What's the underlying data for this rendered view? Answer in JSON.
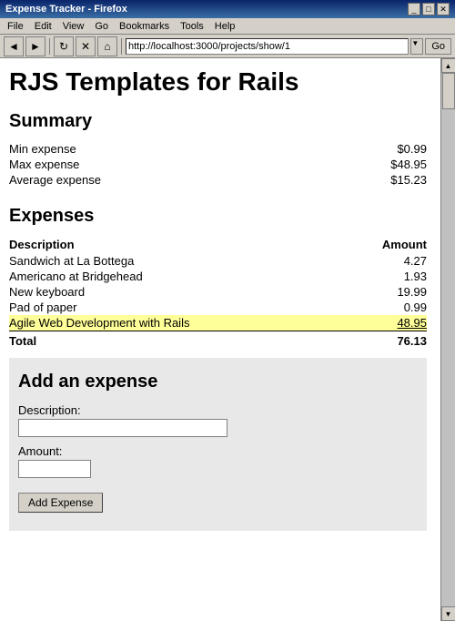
{
  "window": {
    "title": "Expense Tracker - Firefox",
    "controls": {
      "minimize": "_",
      "maximize": "□",
      "close": "✕"
    }
  },
  "menubar": {
    "items": [
      "File",
      "Edit",
      "View",
      "Go",
      "Bookmarks",
      "Tools",
      "Help"
    ]
  },
  "toolbar": {
    "address_label": "",
    "address_value": "http://localhost:3000/projects/show/1",
    "go_label": "Go"
  },
  "page": {
    "title": "RJS Templates for Rails",
    "summary": {
      "heading": "Summary",
      "rows": [
        {
          "label": "Min expense",
          "value": "$0.99"
        },
        {
          "label": "Max expense",
          "value": "$48.95"
        },
        {
          "label": "Average expense",
          "value": "$15.23"
        }
      ]
    },
    "expenses": {
      "heading": "Expenses",
      "columns": {
        "description": "Description",
        "amount": "Amount"
      },
      "rows": [
        {
          "description": "Sandwich at La Bottega",
          "amount": "4.27",
          "highlighted": false
        },
        {
          "description": "Americano at Bridgehead",
          "amount": "1.93",
          "highlighted": false
        },
        {
          "description": "New keyboard",
          "amount": "19.99",
          "highlighted": false
        },
        {
          "description": "Pad of paper",
          "amount": "0.99",
          "highlighted": false
        },
        {
          "description": "Agile Web Development with Rails",
          "amount": "48.95",
          "highlighted": true
        }
      ],
      "total_label": "Total",
      "total_value": "76.13"
    },
    "add_expense": {
      "heading": "Add an expense",
      "description_label": "Description:",
      "amount_label": "Amount:",
      "button_label": "Add Expense",
      "description_placeholder": "",
      "amount_placeholder": ""
    }
  }
}
